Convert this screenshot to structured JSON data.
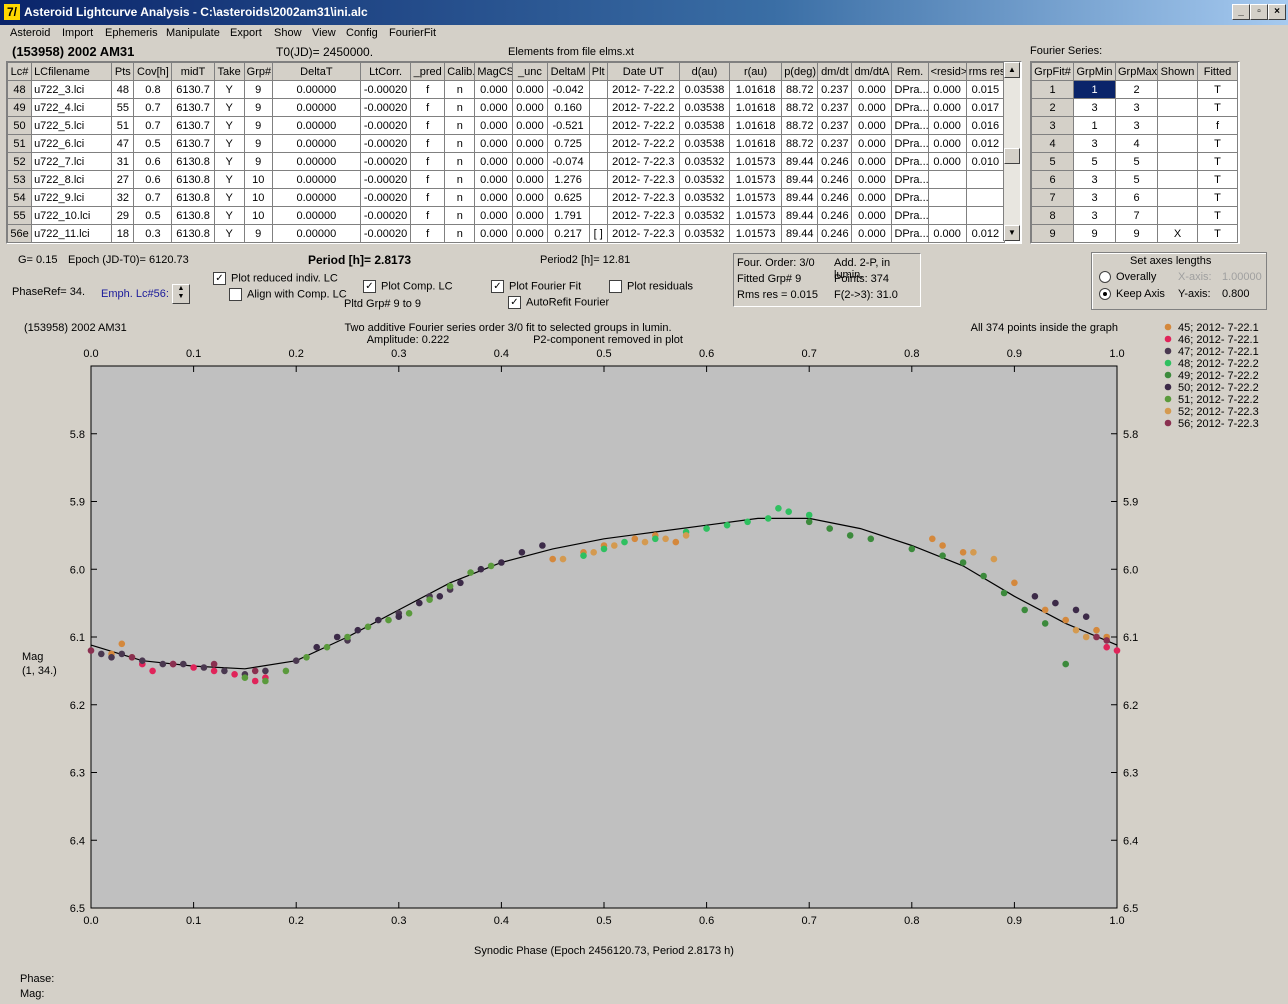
{
  "window": {
    "title": "Asteroid Lightcurve Analysis - C:\\asteroids\\2002am31\\ini.alc",
    "icon_label": "7/"
  },
  "menu": [
    "Asteroid",
    "Import",
    "Ephemeris",
    "Manipulate",
    "Export",
    "Show",
    "View",
    "Config",
    "FourierFit"
  ],
  "header": {
    "object": "(153958) 2002 AM31",
    "t0": "T0(JD)= 2450000.",
    "elements": "Elements from file elms.xt",
    "fourier_title": "Fourier Series:"
  },
  "lc_table": {
    "columns": [
      "Lc#",
      "LCfilename",
      "Pts",
      "Cov[h]",
      "midT",
      "Take",
      "Grp#",
      "DeltaT",
      "LtCorr.",
      "_pred",
      "Calib.",
      "MagCS",
      "_unc",
      "DeltaM",
      "Plt",
      "Date UT",
      "d(au)",
      "r(au)",
      "p(deg)",
      "dm/dt",
      "dm/dtA",
      "Rem.",
      "<resid>",
      "rms res"
    ],
    "rows": [
      [
        "48",
        "u722_3.lci",
        "48",
        "0.8",
        "6130.7",
        "Y",
        "9",
        "0.00000",
        "-0.00020",
        "f",
        "n",
        "0.000",
        "0.000",
        "-0.042",
        "",
        "2012- 7-22.2",
        "0.03538",
        "1.01618",
        "88.72",
        "0.237",
        "0.000",
        "DPra...",
        "0.000",
        "0.015"
      ],
      [
        "49",
        "u722_4.lci",
        "55",
        "0.7",
        "6130.7",
        "Y",
        "9",
        "0.00000",
        "-0.00020",
        "f",
        "n",
        "0.000",
        "0.000",
        "0.160",
        "",
        "2012- 7-22.2",
        "0.03538",
        "1.01618",
        "88.72",
        "0.237",
        "0.000",
        "DPra...",
        "0.000",
        "0.017"
      ],
      [
        "50",
        "u722_5.lci",
        "51",
        "0.7",
        "6130.7",
        "Y",
        "9",
        "0.00000",
        "-0.00020",
        "f",
        "n",
        "0.000",
        "0.000",
        "-0.521",
        "",
        "2012- 7-22.2",
        "0.03538",
        "1.01618",
        "88.72",
        "0.237",
        "0.000",
        "DPra...",
        "0.000",
        "0.016"
      ],
      [
        "51",
        "u722_6.lci",
        "47",
        "0.5",
        "6130.7",
        "Y",
        "9",
        "0.00000",
        "-0.00020",
        "f",
        "n",
        "0.000",
        "0.000",
        "0.725",
        "",
        "2012- 7-22.2",
        "0.03538",
        "1.01618",
        "88.72",
        "0.237",
        "0.000",
        "DPra...",
        "0.000",
        "0.012"
      ],
      [
        "52",
        "u722_7.lci",
        "31",
        "0.6",
        "6130.8",
        "Y",
        "9",
        "0.00000",
        "-0.00020",
        "f",
        "n",
        "0.000",
        "0.000",
        "-0.074",
        "",
        "2012- 7-22.3",
        "0.03532",
        "1.01573",
        "89.44",
        "0.246",
        "0.000",
        "DPra...",
        "0.000",
        "0.010"
      ],
      [
        "53",
        "u722_8.lci",
        "27",
        "0.6",
        "6130.8",
        "Y",
        "10",
        "0.00000",
        "-0.00020",
        "f",
        "n",
        "0.000",
        "0.000",
        "1.276",
        "",
        "2012- 7-22.3",
        "0.03532",
        "1.01573",
        "89.44",
        "0.246",
        "0.000",
        "DPra...",
        "",
        ""
      ],
      [
        "54",
        "u722_9.lci",
        "32",
        "0.7",
        "6130.8",
        "Y",
        "10",
        "0.00000",
        "-0.00020",
        "f",
        "n",
        "0.000",
        "0.000",
        "0.625",
        "",
        "2012- 7-22.3",
        "0.03532",
        "1.01573",
        "89.44",
        "0.246",
        "0.000",
        "DPra...",
        "",
        ""
      ],
      [
        "55",
        "u722_10.lci",
        "29",
        "0.5",
        "6130.8",
        "Y",
        "10",
        "0.00000",
        "-0.00020",
        "f",
        "n",
        "0.000",
        "0.000",
        "1.791",
        "",
        "2012- 7-22.3",
        "0.03532",
        "1.01573",
        "89.44",
        "0.246",
        "0.000",
        "DPra...",
        "",
        ""
      ],
      [
        "56e",
        "u722_11.lci",
        "18",
        "0.3",
        "6130.8",
        "Y",
        "9",
        "0.00000",
        "-0.00020",
        "f",
        "n",
        "0.000",
        "0.000",
        "0.217",
        "[ ]",
        "2012- 7-22.3",
        "0.03532",
        "1.01573",
        "89.44",
        "0.246",
        "0.000",
        "DPra...",
        "0.000",
        "0.012"
      ]
    ]
  },
  "fourier_table": {
    "columns": [
      "GrpFit#",
      "GrpMin",
      "GrpMax",
      "Shown",
      "Fitted"
    ],
    "rows": [
      [
        "1",
        "1",
        "2",
        "",
        "T"
      ],
      [
        "2",
        "3",
        "3",
        "",
        "T"
      ],
      [
        "3",
        "1",
        "3",
        "",
        "f"
      ],
      [
        "4",
        "3",
        "4",
        "",
        "T"
      ],
      [
        "5",
        "5",
        "5",
        "",
        "T"
      ],
      [
        "6",
        "3",
        "5",
        "",
        "T"
      ],
      [
        "7",
        "3",
        "6",
        "",
        "T"
      ],
      [
        "8",
        "3",
        "7",
        "",
        "T"
      ],
      [
        "9",
        "9",
        "9",
        "X",
        "T"
      ]
    ]
  },
  "controls": {
    "g": "G= 0.15",
    "epoch": "Epoch (JD-T0)= 6120.73",
    "period": "Period [h]= 2.8173",
    "period2": "Period2 [h]= 12.81",
    "phaseref": "PhaseRef= 34.",
    "emph": "Emph. Lc#56:",
    "plot_reduced": "Plot reduced indiv. LC",
    "align_comp": "Align with Comp. LC",
    "plot_comp": "Plot Comp. LC",
    "pltd_grp": "Pltd Grp#  9  to   9",
    "plot_fourier": "Plot Fourier Fit",
    "autorefit": "AutoRefit Fourier",
    "plot_residuals": "Plot residuals",
    "checks": {
      "plot_reduced": true,
      "align_comp": false,
      "plot_comp": true,
      "plot_fourier": true,
      "autorefit": true,
      "plot_residuals": false
    }
  },
  "fit_info": {
    "four_order": "Four. Order:  3/0",
    "add": "Add. 2-P, in lumin.",
    "fitted_grp": "Fitted Grp# 9",
    "points": "Points: 374",
    "rms": "Rms res     = 0.015",
    "f23": "F(2->3):  31.0"
  },
  "axes_box": {
    "title": "Set axes lengths",
    "overally": "Overally",
    "keep_axis": "Keep Axis",
    "x_label": "X-axis:",
    "x_val": "1.00000",
    "y_label": "Y-axis:",
    "y_val": "0.800",
    "selected": "keep_axis"
  },
  "chart_texts": {
    "object": "(153958) 2002 AM31",
    "line1": "Two additive Fourier series order 3/0 fit to selected groups in lumin.",
    "line2a": "Amplitude: 0.222",
    "line2b": "P2-component removed in plot",
    "inside": "All 374 points inside the graph",
    "ylabel1": "Mag",
    "ylabel2": "(1, 34.)"
  },
  "status": {
    "phase": "Phase:",
    "mag": "Mag:"
  },
  "chart_data": {
    "type": "scatter",
    "xlabel": "Synodic Phase (Epoch 2456120.73, Period 2.8173 h)",
    "ylabel": "Mag",
    "xlim": [
      0.0,
      1.0
    ],
    "ylim": [
      5.7,
      6.5
    ],
    "y_inverted": true,
    "x_ticks": [
      "0.0",
      "0.1",
      "0.2",
      "0.3",
      "0.4",
      "0.5",
      "0.6",
      "0.7",
      "0.8",
      "0.9",
      "1.0"
    ],
    "y_ticks": [
      "5.8",
      "5.9",
      "6.0",
      "6.1",
      "6.2",
      "6.3",
      "6.4",
      "6.5"
    ],
    "legend_position": "right",
    "series": [
      {
        "name": "45; 2012- 7-22.1",
        "color": "#d4883c",
        "points": [
          [
            0.02,
            6.125
          ],
          [
            0.03,
            6.11
          ],
          [
            0.04,
            6.13
          ],
          [
            0.45,
            5.985
          ],
          [
            0.48,
            5.975
          ],
          [
            0.5,
            5.965
          ],
          [
            0.53,
            5.955
          ],
          [
            0.55,
            5.95
          ],
          [
            0.57,
            5.96
          ],
          [
            0.82,
            5.955
          ],
          [
            0.83,
            5.965
          ],
          [
            0.85,
            5.975
          ],
          [
            0.9,
            6.02
          ],
          [
            0.93,
            6.06
          ],
          [
            0.95,
            6.075
          ],
          [
            0.98,
            6.09
          ],
          [
            0.99,
            6.1
          ]
        ]
      },
      {
        "name": "46; 2012- 7-22.1",
        "color": "#e0245a",
        "points": [
          [
            0.05,
            6.14
          ],
          [
            0.06,
            6.15
          ],
          [
            0.08,
            6.14
          ],
          [
            0.1,
            6.145
          ],
          [
            0.12,
            6.15
          ],
          [
            0.14,
            6.155
          ],
          [
            0.16,
            6.165
          ],
          [
            0.17,
            6.16
          ],
          [
            0.99,
            6.115
          ],
          [
            1.0,
            6.12
          ]
        ]
      },
      {
        "name": "47; 2012- 7-22.1",
        "color": "#4a3850",
        "points": [
          [
            0.01,
            6.125
          ],
          [
            0.02,
            6.13
          ],
          [
            0.03,
            6.125
          ],
          [
            0.05,
            6.135
          ],
          [
            0.07,
            6.14
          ],
          [
            0.09,
            6.14
          ],
          [
            0.11,
            6.145
          ],
          [
            0.13,
            6.15
          ],
          [
            0.15,
            6.155
          ],
          [
            0.17,
            6.15
          ],
          [
            0.2,
            6.135
          ],
          [
            0.25,
            6.105
          ],
          [
            0.3,
            6.065
          ],
          [
            0.33,
            6.04
          ],
          [
            0.35,
            6.03
          ]
        ]
      },
      {
        "name": "48; 2012- 7-22.2",
        "color": "#2fc060",
        "points": [
          [
            0.48,
            5.98
          ],
          [
            0.5,
            5.97
          ],
          [
            0.52,
            5.96
          ],
          [
            0.55,
            5.955
          ],
          [
            0.58,
            5.945
          ],
          [
            0.6,
            5.94
          ],
          [
            0.62,
            5.935
          ],
          [
            0.64,
            5.93
          ],
          [
            0.66,
            5.925
          ],
          [
            0.67,
            5.91
          ],
          [
            0.68,
            5.915
          ],
          [
            0.7,
            5.92
          ]
        ]
      },
      {
        "name": "49; 2012- 7-22.2",
        "color": "#3c8a3c",
        "points": [
          [
            0.7,
            5.93
          ],
          [
            0.72,
            5.94
          ],
          [
            0.74,
            5.95
          ],
          [
            0.76,
            5.955
          ],
          [
            0.8,
            5.97
          ],
          [
            0.83,
            5.98
          ],
          [
            0.85,
            5.99
          ],
          [
            0.87,
            6.01
          ],
          [
            0.89,
            6.035
          ],
          [
            0.91,
            6.06
          ],
          [
            0.93,
            6.08
          ],
          [
            0.95,
            6.14
          ]
        ]
      },
      {
        "name": "50; 2012- 7-22.2",
        "color": "#3c2a48",
        "points": [
          [
            0.22,
            6.115
          ],
          [
            0.24,
            6.1
          ],
          [
            0.26,
            6.09
          ],
          [
            0.28,
            6.075
          ],
          [
            0.3,
            6.07
          ],
          [
            0.32,
            6.05
          ],
          [
            0.34,
            6.04
          ],
          [
            0.36,
            6.02
          ],
          [
            0.38,
            6.0
          ],
          [
            0.4,
            5.99
          ],
          [
            0.42,
            5.975
          ],
          [
            0.44,
            5.965
          ],
          [
            0.92,
            6.04
          ],
          [
            0.94,
            6.05
          ],
          [
            0.96,
            6.06
          ],
          [
            0.97,
            6.07
          ]
        ]
      },
      {
        "name": "51; 2012- 7-22.2",
        "color": "#5a9a3c",
        "points": [
          [
            0.15,
            6.16
          ],
          [
            0.17,
            6.165
          ],
          [
            0.19,
            6.15
          ],
          [
            0.21,
            6.13
          ],
          [
            0.23,
            6.115
          ],
          [
            0.25,
            6.1
          ],
          [
            0.27,
            6.085
          ],
          [
            0.29,
            6.075
          ],
          [
            0.31,
            6.065
          ],
          [
            0.33,
            6.045
          ],
          [
            0.35,
            6.025
          ],
          [
            0.37,
            6.005
          ],
          [
            0.39,
            5.995
          ]
        ]
      },
      {
        "name": "52; 2012- 7-22.3",
        "color": "#d49a50",
        "points": [
          [
            0.46,
            5.985
          ],
          [
            0.49,
            5.975
          ],
          [
            0.51,
            5.965
          ],
          [
            0.54,
            5.96
          ],
          [
            0.56,
            5.955
          ],
          [
            0.58,
            5.95
          ],
          [
            0.86,
            5.975
          ],
          [
            0.88,
            5.985
          ],
          [
            0.96,
            6.09
          ],
          [
            0.97,
            6.1
          ]
        ]
      },
      {
        "name": "56; 2012- 7-22.3",
        "color": "#8a3050",
        "points": [
          [
            0.0,
            6.12
          ],
          [
            0.04,
            6.13
          ],
          [
            0.08,
            6.14
          ],
          [
            0.12,
            6.14
          ],
          [
            0.16,
            6.15
          ],
          [
            0.98,
            6.1
          ],
          [
            0.99,
            6.105
          ]
        ]
      }
    ],
    "fit_curve": [
      [
        0.0,
        6.112
      ],
      [
        0.05,
        6.135
      ],
      [
        0.1,
        6.143
      ],
      [
        0.15,
        6.147
      ],
      [
        0.2,
        6.135
      ],
      [
        0.25,
        6.1
      ],
      [
        0.3,
        6.06
      ],
      [
        0.35,
        6.02
      ],
      [
        0.4,
        5.99
      ],
      [
        0.45,
        5.97
      ],
      [
        0.5,
        5.955
      ],
      [
        0.55,
        5.945
      ],
      [
        0.6,
        5.935
      ],
      [
        0.65,
        5.925
      ],
      [
        0.7,
        5.925
      ],
      [
        0.75,
        5.94
      ],
      [
        0.8,
        5.965
      ],
      [
        0.85,
        5.995
      ],
      [
        0.9,
        6.04
      ],
      [
        0.95,
        6.08
      ],
      [
        1.0,
        6.112
      ]
    ]
  }
}
